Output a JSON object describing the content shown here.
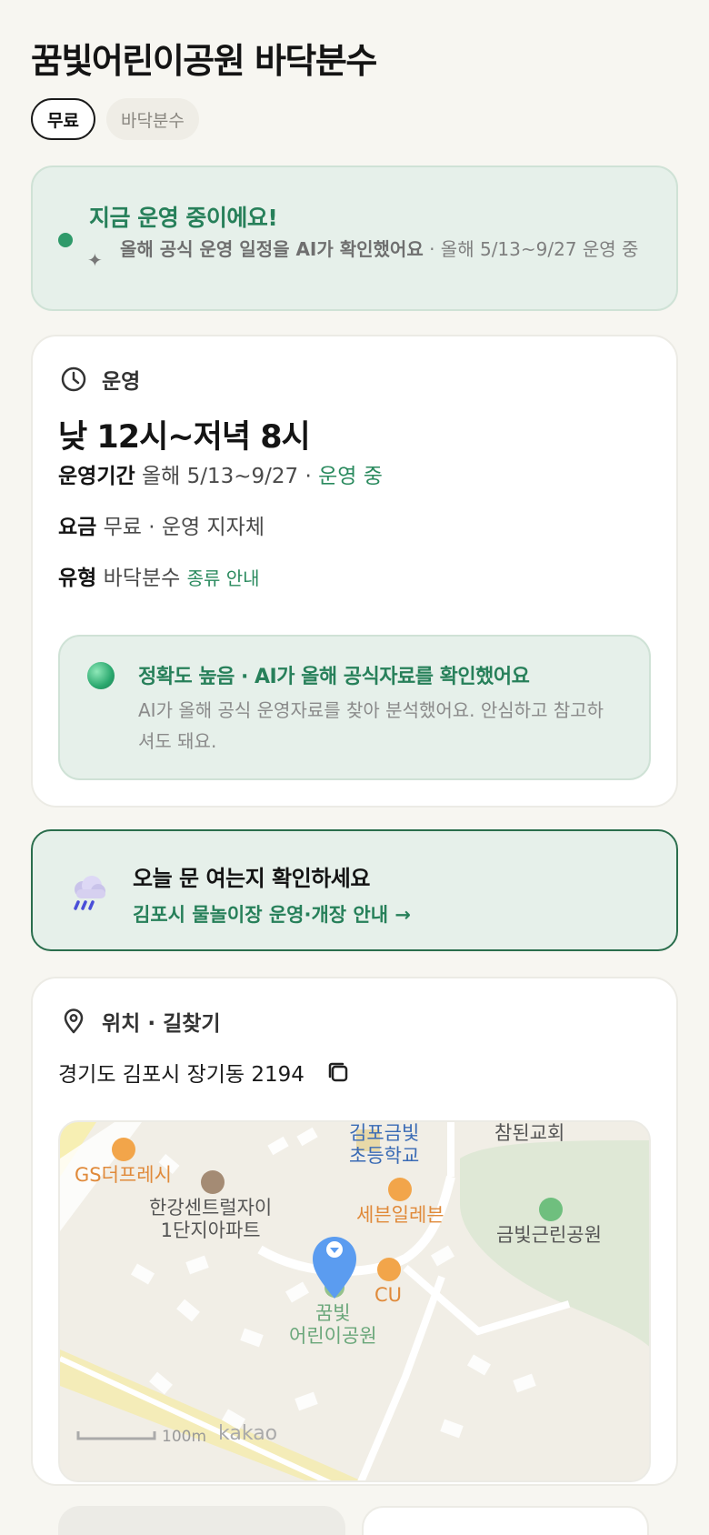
{
  "header": {
    "title": "꿈빛어린이공원 바닥분수",
    "chips": [
      "무료",
      "바닥분수"
    ]
  },
  "status": {
    "title": "지금 운영 중이에요!",
    "sub_bold": "올해 공식 운영 일정을 AI가 확인했어요",
    "sub_rest": " · 올해 5/13~9/27 운영 중"
  },
  "operation": {
    "section_label": "운영",
    "hours": "낮 12시~저녁 8시",
    "period_label": "운영기간",
    "period_value": "올해 5/13~9/27 · ",
    "period_status": "운영 중",
    "fee_label": "요금",
    "fee_value": "무료 · 운영 지자체",
    "type_label": "유형",
    "type_value": "바닥분수",
    "type_link": "종류 안내",
    "accuracy_title": "정확도 높음 · AI가 올해 공식자료를 확인했어요",
    "accuracy_text": "AI가 올해 공식 운영자료를 찾아 분석했어요. 안심하고 참고하셔도 돼요."
  },
  "banner": {
    "title": "오늘 문 여는지 확인하세요",
    "link": "김포시 물놀이장 운영·개장 안내 →"
  },
  "location": {
    "section_label": "위치 · 길찾기",
    "address": "경기도 김포시 장기동 2194",
    "map_labels": {
      "school": "김포금빛\n초등학교",
      "church": "참된교회",
      "gs": "GS더프레시",
      "apartment": "한강센트럴자이\n1단지아파트",
      "seven": "세븐일레븐",
      "park_near": "금빛근린공원",
      "cu": "CU",
      "target": "꿈빛\n어린이공원",
      "scale": "100m",
      "brand": "kakao"
    }
  },
  "colors": {
    "accent_green": "#27805a",
    "status_bg": "#e6f0ea",
    "page_bg": "#f7f6f1",
    "pin_blue": "#5b9cf0"
  }
}
